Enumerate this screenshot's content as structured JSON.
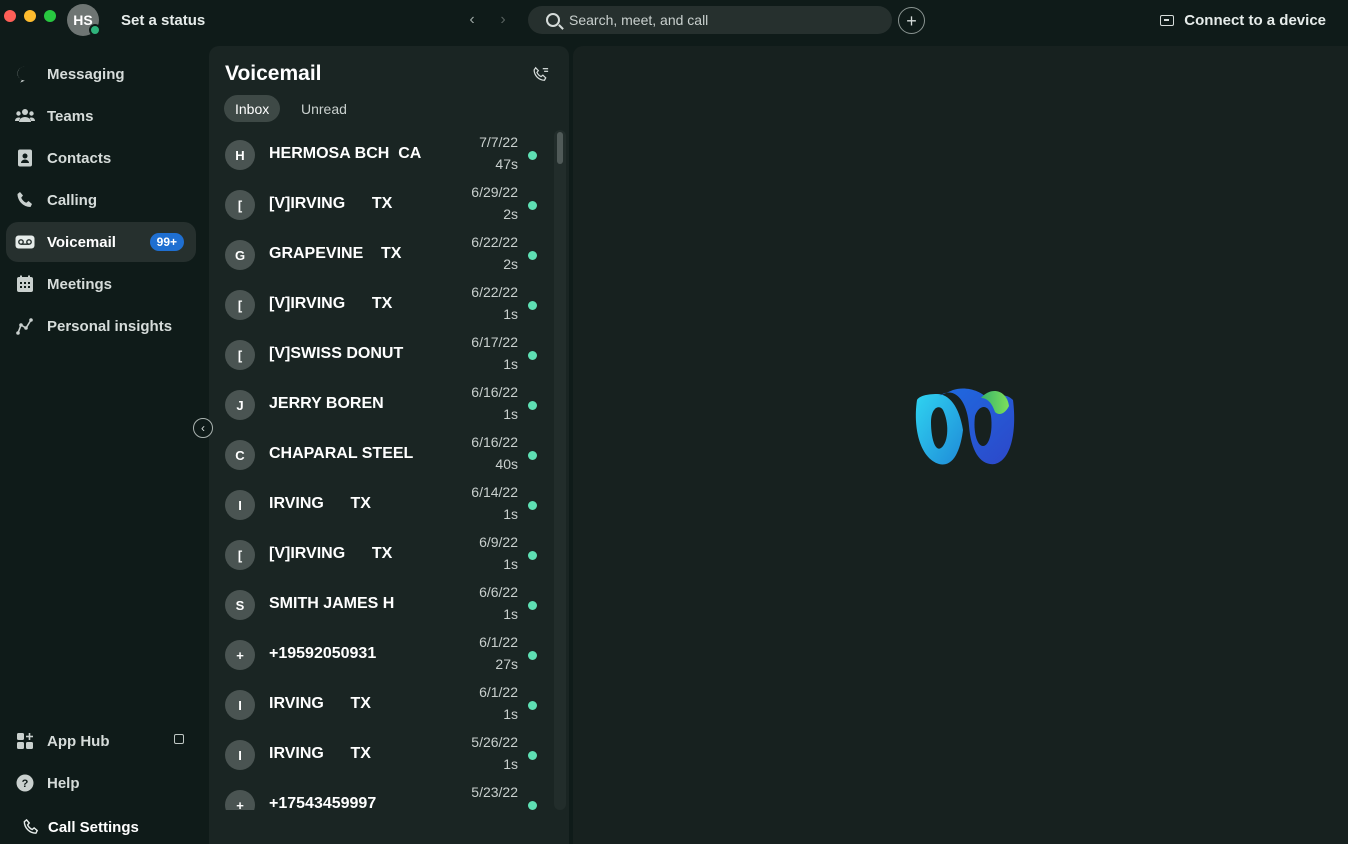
{
  "header": {
    "avatar_initials": "HS",
    "status_text": "Set a status",
    "search_placeholder": "Search, meet, and call",
    "connect_label": "Connect to a device"
  },
  "sidebar": {
    "items": [
      {
        "label": "Messaging",
        "icon": "chat-bubble-icon"
      },
      {
        "label": "Teams",
        "icon": "people-icon"
      },
      {
        "label": "Contacts",
        "icon": "contacts-book-icon"
      },
      {
        "label": "Calling",
        "icon": "phone-icon"
      },
      {
        "label": "Voicemail",
        "icon": "voicemail-icon",
        "badge": "99+",
        "active": true
      },
      {
        "label": "Meetings",
        "icon": "calendar-icon"
      },
      {
        "label": "Personal insights",
        "icon": "insights-icon"
      }
    ],
    "bottom": [
      {
        "label": "App Hub",
        "icon": "app-hub-icon"
      },
      {
        "label": "Help",
        "icon": "help-icon"
      }
    ],
    "call_settings": "Call Settings"
  },
  "voicemail": {
    "title": "Voicemail",
    "tabs": [
      "Inbox",
      "Unread"
    ],
    "active_tab": "Inbox",
    "items": [
      {
        "initial": "H",
        "name": "HERMOSA BCH  CA",
        "date": "7/7/22",
        "duration": "47s"
      },
      {
        "initial": "[",
        "name": "[V]IRVING      TX",
        "date": "6/29/22",
        "duration": "2s"
      },
      {
        "initial": "G",
        "name": "GRAPEVINE    TX",
        "date": "6/22/22",
        "duration": "2s"
      },
      {
        "initial": "[",
        "name": "[V]IRVING      TX",
        "date": "6/22/22",
        "duration": "1s"
      },
      {
        "initial": "[",
        "name": "[V]SWISS DONUT",
        "date": "6/17/22",
        "duration": "1s"
      },
      {
        "initial": "J",
        "name": "JERRY BOREN",
        "date": "6/16/22",
        "duration": "1s"
      },
      {
        "initial": "C",
        "name": "CHAPARAL STEEL",
        "date": "6/16/22",
        "duration": "40s"
      },
      {
        "initial": "I",
        "name": "IRVING      TX",
        "date": "6/14/22",
        "duration": "1s"
      },
      {
        "initial": "[",
        "name": "[V]IRVING      TX",
        "date": "6/9/22",
        "duration": "1s"
      },
      {
        "initial": "S",
        "name": "SMITH JAMES H",
        "date": "6/6/22",
        "duration": "1s"
      },
      {
        "initial": "+",
        "name": "+19592050931",
        "date": "6/1/22",
        "duration": "27s"
      },
      {
        "initial": "I",
        "name": "IRVING      TX",
        "date": "6/1/22",
        "duration": "1s"
      },
      {
        "initial": "I",
        "name": "IRVING      TX",
        "date": "5/26/22",
        "duration": "1s"
      },
      {
        "initial": "+",
        "name": "+17543459997",
        "date": "5/23/22",
        "duration": ""
      }
    ]
  },
  "colors": {
    "accent_badge": "#1f6fd1",
    "unread_dot": "#5fe0b4",
    "background": "#0f1b19"
  }
}
